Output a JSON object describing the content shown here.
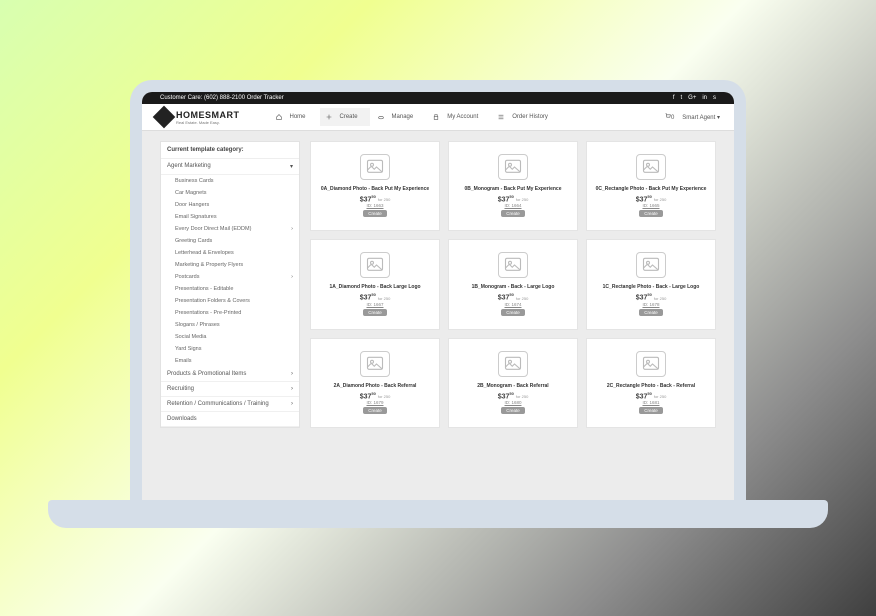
{
  "topbar": {
    "left": "Customer Care: (602) 888-2100    Order Tracker",
    "social": [
      "f",
      "t",
      "G+",
      "in",
      "s"
    ]
  },
  "logo": {
    "text": "HOMESMART",
    "sub": "Real Estate. Made Easy."
  },
  "nav": {
    "items": [
      "Home",
      "Create",
      "Manage",
      "My Account",
      "Order History"
    ],
    "active": 1,
    "cart": "0",
    "user": "Smart Agent"
  },
  "sidebar": {
    "heading": "Current template category:",
    "groups": [
      {
        "label": "Agent Marketing",
        "expand": true,
        "subs": [
          "Business Cards",
          "Car Magnets",
          "Door Hangers",
          "Email Signatures",
          "Every Door Direct Mail (EDDM)",
          "Greeting Cards",
          "Letterhead & Envelopes",
          "Marketing & Property Flyers",
          "Postcards",
          "Presentations - Editable",
          "Presentation Folders & Covers",
          "Presentations - Pre-Printed",
          "Slogans / Phrases",
          "Social Media",
          "Yard Signs",
          "Emails"
        ]
      },
      {
        "label": "Products & Promotional Items",
        "expand": false
      },
      {
        "label": "Recruiting",
        "expand": false
      },
      {
        "label": "Retention / Communications / Training",
        "expand": false
      },
      {
        "label": "Downloads",
        "expand": false
      }
    ]
  },
  "price": {
    "whole": "$37",
    "cents": "50",
    "per": "for 250"
  },
  "btn": "Create",
  "cards": [
    {
      "title": "0A_Diamond Photo - Back Put My Experience",
      "id": "ID: 1663"
    },
    {
      "title": "0B_Monogram - Back Put My Experience",
      "id": "ID: 1664"
    },
    {
      "title": "0C_Rectangle Photo - Back Put My Experience",
      "id": "ID: 1665"
    },
    {
      "title": "1A_Diamond Photo - Back Large Logo",
      "id": "ID: 1667"
    },
    {
      "title": "1B_Monogram - Back - Large Logo",
      "id": "ID: 1674"
    },
    {
      "title": "1C_Rectangle Photo - Back - Large Logo",
      "id": "ID: 1678"
    },
    {
      "title": "2A_Diamond Photo - Back Referral",
      "id": "ID: 1679"
    },
    {
      "title": "2B_Monogram - Back Referral",
      "id": "ID: 1680"
    },
    {
      "title": "2C_Rectangle Photo - Back - Referral",
      "id": "ID: 1681"
    }
  ]
}
